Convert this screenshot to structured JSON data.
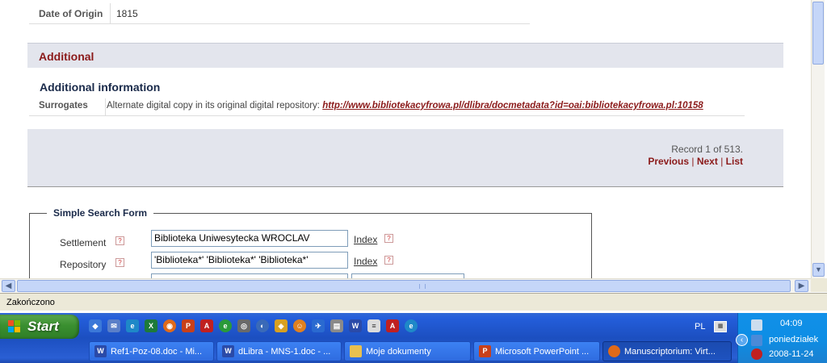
{
  "record": {
    "date_of_origin_label": "Date of Origin",
    "date_of_origin_value": "1815"
  },
  "additional": {
    "section_title": "Additional",
    "info_title": "Additional information",
    "surrogates_label": "Surrogates",
    "surrogates_text": "Alternate digital copy in its original digital repository:",
    "surrogates_link": "http://www.bibliotekacyfrowa.pl/dlibra/docmetadata?id=oai:bibliotekacyfrowa.pl:10158"
  },
  "navigation": {
    "record_count": "Record 1 of 513.",
    "previous": "Previous",
    "next": "Next",
    "list": "List",
    "separator": "|"
  },
  "search_form": {
    "legend": "Simple Search Form",
    "help_glyph": "?",
    "fields": [
      {
        "label": "Settlement",
        "value": "Biblioteka Uniwesytecka  WROCLAV",
        "index_label": "Index"
      },
      {
        "label": "Repository",
        "value": " 'Biblioteka*'   'Biblioteka*'   'Biblioteka*'",
        "index_label": "Index"
      }
    ]
  },
  "browser": {
    "status_text": "Zakończono"
  },
  "taskbar": {
    "start_label": "Start",
    "language": "PL",
    "time": "04:09",
    "day": "poniedziałek",
    "date": "2008-11-24",
    "buttons": [
      {
        "label": "Ref1-Poz-08.doc - Mi...",
        "icon": "word-icon",
        "active": false
      },
      {
        "label": "dLibra - MNS-1.doc - ...",
        "icon": "word-icon",
        "active": false
      },
      {
        "label": "Moje dokumenty",
        "icon": "folder-icon",
        "active": false
      },
      {
        "label": "Microsoft PowerPoint ...",
        "icon": "powerpoint-icon",
        "active": false
      },
      {
        "label": "Manuscriptorium: Virt...",
        "icon": "firefox-icon",
        "active": true
      }
    ]
  },
  "colors": {
    "accent": "#8b1a1a",
    "section_bg": "#e3e5ed",
    "taskbar_blue": "#245edb",
    "start_green": "#3a8f30"
  }
}
